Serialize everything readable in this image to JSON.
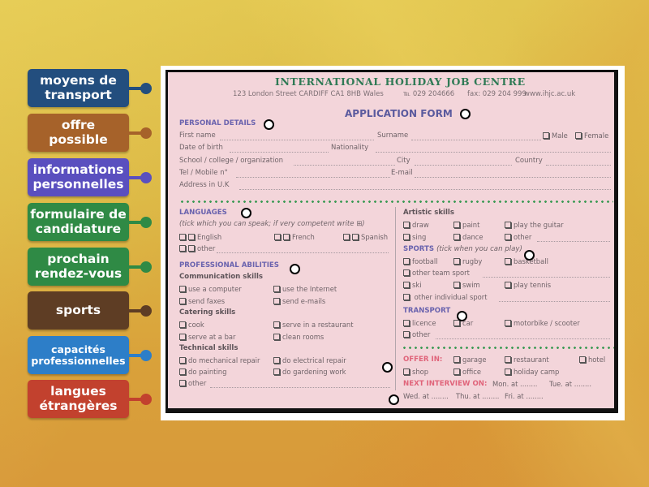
{
  "labels": [
    {
      "id": "moyens-de-transport",
      "lines": [
        "moyens de",
        "transport"
      ],
      "color": "#234e7e"
    },
    {
      "id": "offre-possible",
      "lines": [
        "offre",
        "possible"
      ],
      "color": "#a6622a"
    },
    {
      "id": "informations-personnelles",
      "lines": [
        "informations",
        "personnelles"
      ],
      "color": "#5a4fbf"
    },
    {
      "id": "formulaire-de-candidature",
      "lines": [
        "formulaire de",
        "candidature"
      ],
      "color": "#2f8a45"
    },
    {
      "id": "prochain-rendez-vous",
      "lines": [
        "prochain",
        "rendez-vous"
      ],
      "color": "#2f8a45"
    },
    {
      "id": "sports",
      "lines": [
        "sports"
      ],
      "color": "#5e3d24"
    },
    {
      "id": "capacites-professionnelles",
      "lines": [
        "capacités",
        "professionnelles"
      ],
      "color": "#2d7ec8"
    },
    {
      "id": "langues-etrangeres",
      "lines": [
        "langues",
        "étrangères"
      ],
      "color": "#c2412e"
    }
  ],
  "form": {
    "title": "INTERNATIONAL HOLIDAY JOB CENTRE",
    "address": "123 London Street    CARDIFF  CA1 8HB  Wales",
    "phone": "℡ 029 204666",
    "phone_icon": "phone-icon",
    "fax": "fax: 029 204 999",
    "website": "www.ihjc.ac.uk",
    "heading": "APPLICATION FORM",
    "personal": {
      "title": "PERSONAL DETAILS",
      "first_name": "First name",
      "surname": "Surname",
      "male": "Male",
      "female": "Female",
      "dob": "Date of birth",
      "nationality": "Nationality",
      "school": "School / college / organization",
      "city": "City",
      "country": "Country",
      "tel": "Tel / Mobile n°",
      "email": "E-mail",
      "address": "Address in U.K"
    },
    "languages": {
      "title": "LANGUAGES",
      "note": "(tick which you can speak; if very competent write ⊞)",
      "items": [
        "English",
        "French",
        "Spanish"
      ],
      "other": "other"
    },
    "professional": {
      "title": "PROFESSIONAL ABILITIES",
      "communication": {
        "title": "Communication skills",
        "items": [
          "use a computer",
          "use the Internet",
          "send faxes",
          "send e-mails"
        ]
      },
      "catering": {
        "title": "Catering skills",
        "items": [
          "cook",
          "serve in a restaurant",
          "serve at a bar",
          "clean rooms"
        ]
      },
      "technical": {
        "title": "Technical skills",
        "items": [
          "do mechanical repair",
          "do electrical repair",
          "do painting",
          "do gardening work"
        ],
        "other": "other"
      }
    },
    "artistic": {
      "title": "Artistic skills",
      "items": [
        "draw",
        "paint",
        "play the guitar",
        "sing",
        "dance",
        "other"
      ]
    },
    "sports": {
      "title": "SPORTS",
      "note": "(tick when you can play)",
      "items": [
        "football",
        "rugby",
        "basketball"
      ],
      "team": "other team sport",
      "items2": [
        "ski",
        "swim",
        "play tennis"
      ],
      "individual": "other individual sport"
    },
    "transport": {
      "title": "TRANSPORT",
      "items": [
        "licence",
        "car",
        "motorbike / scooter"
      ],
      "other": "other"
    },
    "offer": {
      "title": "OFFER IN:",
      "items": [
        "garage",
        "restaurant",
        "hotel",
        "shop",
        "office",
        "holiday camp"
      ]
    },
    "interview": {
      "title": "NEXT INTERVIEW ON:",
      "days": [
        "Mon. at ........",
        "Tue. at ........",
        "Wed. at ........",
        "Thu. at ........",
        "Fri. at ........"
      ]
    }
  }
}
